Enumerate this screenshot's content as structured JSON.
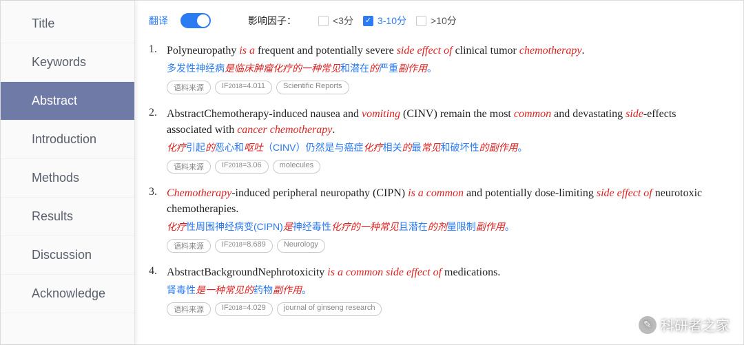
{
  "sidebar": {
    "items": [
      {
        "label": "Title",
        "active": false
      },
      {
        "label": "Keywords",
        "active": false
      },
      {
        "label": "Abstract",
        "active": true
      },
      {
        "label": "Introduction",
        "active": false
      },
      {
        "label": "Methods",
        "active": false
      },
      {
        "label": "Results",
        "active": false
      },
      {
        "label": "Discussion",
        "active": false
      },
      {
        "label": "Acknowledge",
        "active": false
      }
    ]
  },
  "topbar": {
    "translate_label": "翻译",
    "translate_on": true,
    "factor_label": "影响因子：",
    "options": [
      {
        "label": "<3分",
        "checked": false
      },
      {
        "label": "3-10分",
        "checked": true
      },
      {
        "label": ">10分",
        "checked": false
      }
    ]
  },
  "entries": [
    {
      "num": "1.",
      "en": [
        {
          "t": "Polyneuropathy "
        },
        {
          "t": "is a",
          "hl": true
        },
        {
          "t": " frequent and potentially severe "
        },
        {
          "t": "side effect of",
          "hl": true
        },
        {
          "t": " clinical tumor "
        },
        {
          "t": "chemotherapy",
          "hl": true
        },
        {
          "t": "."
        }
      ],
      "zh": [
        {
          "t": "多发性神经病"
        },
        {
          "t": "是临床肿瘤化疗的一种常见",
          "hl": true
        },
        {
          "t": "和潜在"
        },
        {
          "t": "的",
          "hl": true
        },
        {
          "t": "严重"
        },
        {
          "t": "副作用",
          "hl": true
        },
        {
          "t": "。"
        }
      ],
      "tags": [
        "语料来源",
        "IF₍2018₎=4.011",
        "Scientific Reports"
      ]
    },
    {
      "num": "2.",
      "en": [
        {
          "t": "AbstractChemotherapy-induced nausea and "
        },
        {
          "t": "vomiting",
          "hl": true
        },
        {
          "t": " (CINV) remain the most "
        },
        {
          "t": "common",
          "hl": true
        },
        {
          "t": " and devastating "
        },
        {
          "t": "side",
          "hl": true
        },
        {
          "t": "-effects associated with "
        },
        {
          "t": "cancer chemotherapy",
          "hl": true
        },
        {
          "t": "."
        }
      ],
      "zh": [
        {
          "t": "化疗",
          "hl": true
        },
        {
          "t": "引起"
        },
        {
          "t": "的",
          "hl": true
        },
        {
          "t": "恶心和"
        },
        {
          "t": "呕吐",
          "hl": true
        },
        {
          "t": "（CINV）仍然是与癌症"
        },
        {
          "t": "化疗",
          "hl": true
        },
        {
          "t": "相关"
        },
        {
          "t": "的",
          "hl": true
        },
        {
          "t": "最"
        },
        {
          "t": "常见",
          "hl": true
        },
        {
          "t": "和破坏性"
        },
        {
          "t": "的副作用",
          "hl": true
        },
        {
          "t": "。"
        }
      ],
      "tags": [
        "语料来源",
        "IF₍2018₎=3.06",
        "molecules"
      ]
    },
    {
      "num": "3.",
      "en": [
        {
          "t": "Chemotherapy",
          "hl": true
        },
        {
          "t": "-induced peripheral neuropathy (CIPN) "
        },
        {
          "t": "is a common",
          "hl": true
        },
        {
          "t": " and potentially dose-limiting "
        },
        {
          "t": "side effect of",
          "hl": true
        },
        {
          "t": " neurotoxic chemotherapies."
        }
      ],
      "zh": [
        {
          "t": "化疗",
          "hl": true
        },
        {
          "t": "性周围神经病变(CIPN)"
        },
        {
          "t": "是",
          "hl": true
        },
        {
          "t": "神经毒性"
        },
        {
          "t": "化疗的一种常见",
          "hl": true
        },
        {
          "t": "且潜在"
        },
        {
          "t": "的剂",
          "hl": true
        },
        {
          "t": "量限制"
        },
        {
          "t": "副作用",
          "hl": true
        },
        {
          "t": "。"
        }
      ],
      "tags": [
        "语料来源",
        "IF₍2018₎=8.689",
        "Neurology"
      ]
    },
    {
      "num": "4.",
      "en": [
        {
          "t": "AbstractBackgroundNephrotoxicity "
        },
        {
          "t": "is a common side effect of",
          "hl": true
        },
        {
          "t": " medications."
        }
      ],
      "zh": [
        {
          "t": "肾毒性"
        },
        {
          "t": "是一种常见的",
          "hl": true
        },
        {
          "t": "药物"
        },
        {
          "t": "副作用",
          "hl": true
        },
        {
          "t": "。"
        }
      ],
      "tags": [
        "语料来源",
        "IF₍2018₎=4.029",
        "journal of ginseng research"
      ]
    }
  ],
  "watermark": {
    "text": "科研者之家"
  }
}
